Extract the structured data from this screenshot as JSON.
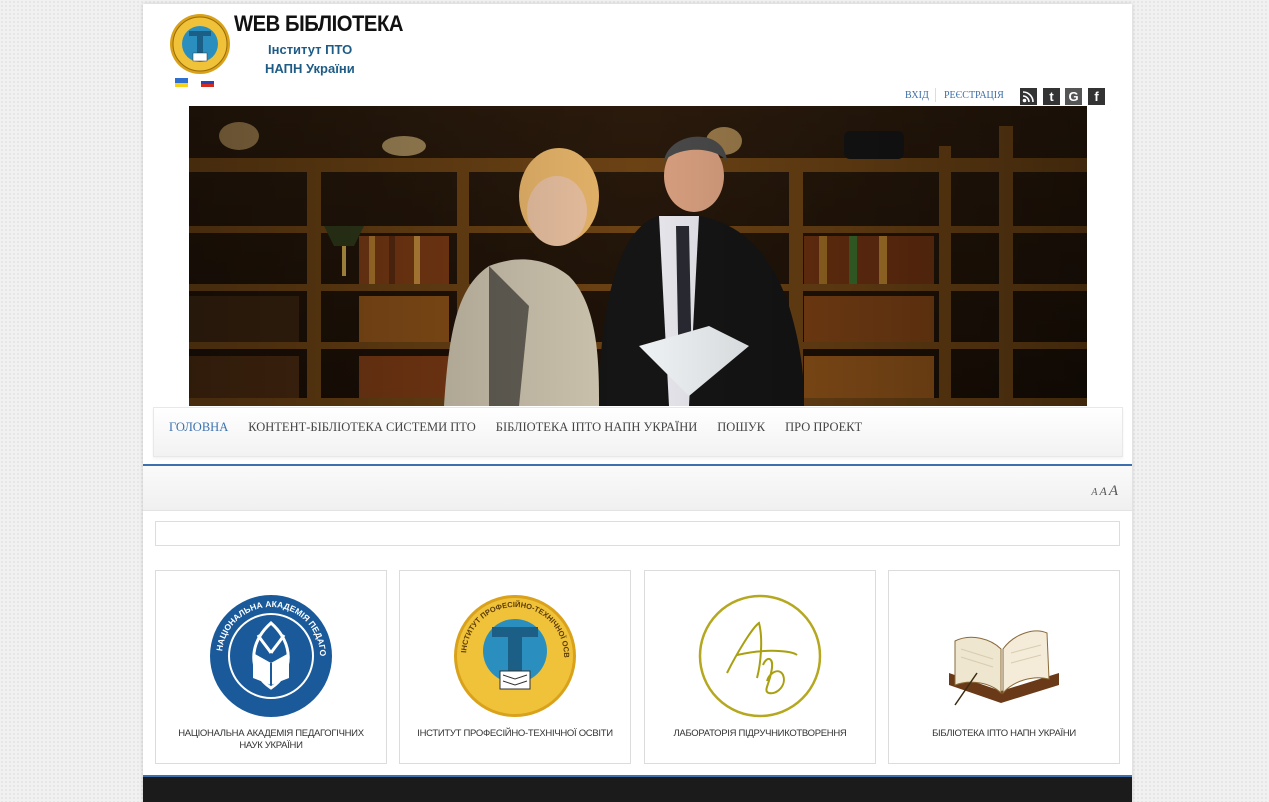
{
  "header": {
    "title": "WEB БІБЛІОТЕКА",
    "subtitle_line1": "Інститут ПТО",
    "subtitle_line2": "НАПН України",
    "languages": [
      "uk",
      "ru"
    ]
  },
  "auth": {
    "login": "ВХІД",
    "register": "РЕЄСТРАЦІЯ"
  },
  "social": {
    "rss": "rss-icon",
    "tumblr": "t",
    "google": "G",
    "facebook": "f"
  },
  "nav": {
    "items": [
      {
        "label": "ГОЛОВНА"
      },
      {
        "label": "КОНТЕНТ-БІБЛІОТЕКА СИСТЕМИ ПТО"
      },
      {
        "label": "БІБЛІОТЕКА ІПТО НАПН УКРАЇНИ"
      },
      {
        "label": "ПОШУК"
      },
      {
        "label": "ПРО ПРОЕКТ"
      }
    ]
  },
  "font_size": {
    "small": "A",
    "medium": "A",
    "large": "A"
  },
  "cards": [
    {
      "caption": "НАЦІОНАЛЬНА АКАДЕМІЯ ПЕДАГОГІЧНИХ НАУК УКРАЇНИ",
      "icon": "napn-seal-icon",
      "seal_text": "НАЦІОНАЛЬНА АКАДЕМІЯ ПЕДАГОГІЧНИХ НАУК УКРАЇНИ"
    },
    {
      "caption": "ІНСТИТУТ ПРОФЕСІЙНО-ТЕХНІЧНОЇ ОСВІТИ",
      "icon": "ipto-seal-icon",
      "seal_text": "ІНСТИТУТ ПРОФЕСІЙНО-ТЕХНІЧНОЇ ОСВІТИ"
    },
    {
      "caption": "ЛАБОРАТОРІЯ ПІДРУЧНИКОТВОРЕННЯ",
      "icon": "lab-monogram-icon"
    },
    {
      "caption": "БІБЛІОТЕКА ІПТО НАПН УКРАЇНИ",
      "icon": "open-book-icon"
    }
  ],
  "colors": {
    "accent": "#3e6fae",
    "nav_active": "#3b72b0",
    "title_blue": "#1e5c86",
    "footer": "#1b1b1b"
  }
}
